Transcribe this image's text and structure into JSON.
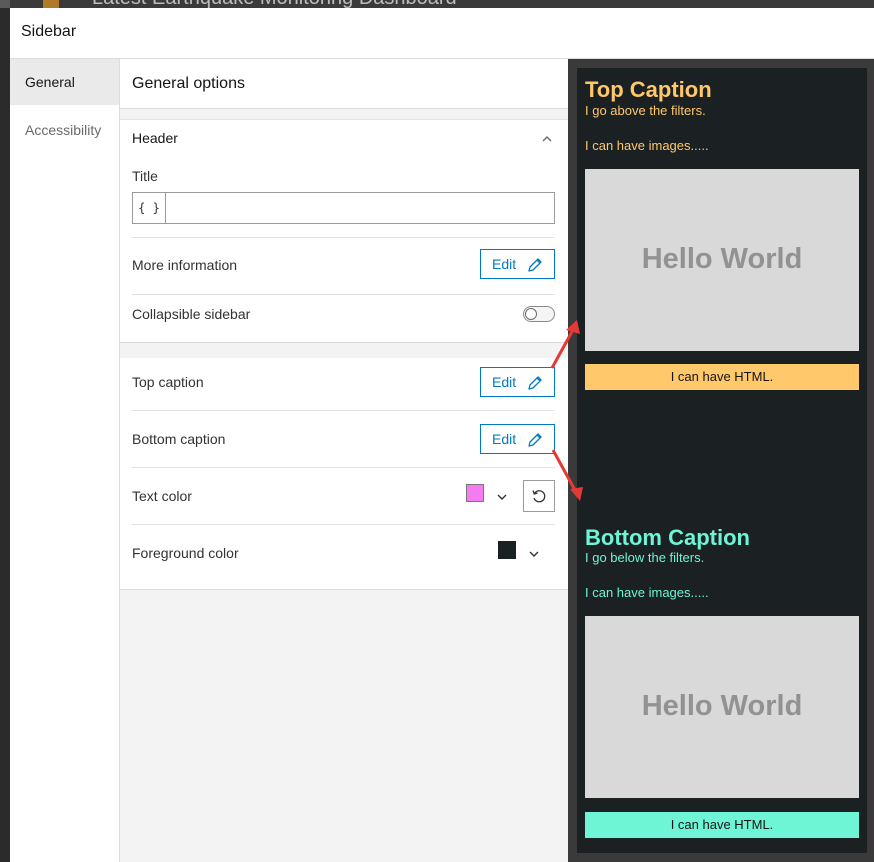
{
  "background_app": {
    "title": "Latest Earthquake Monitoring Dashboard"
  },
  "dialog": {
    "title": "Sidebar"
  },
  "nav": {
    "items": [
      {
        "label": "General"
      },
      {
        "label": "Accessibility"
      }
    ]
  },
  "panel": {
    "title": "General options",
    "header_section": {
      "label": "Header",
      "title_label": "Title",
      "title_value": "",
      "title_placeholder": "",
      "brace_glyph": "{ }",
      "more_info_label": "More information",
      "collapsible_label": "Collapsible sidebar",
      "collapsible_on": false
    },
    "edit_label": "Edit",
    "top_caption_label": "Top caption",
    "bottom_caption_label": "Bottom caption",
    "text_color_label": "Text color",
    "text_color_value": "#f47cf0",
    "foreground_color_label": "Foreground color",
    "foreground_color_value": "#1b2023"
  },
  "preview": {
    "top": {
      "heading": "Top Caption",
      "sub": "I go above the filters.",
      "images_text": "I can have images.....",
      "image_text": "Hello World",
      "html_text": "I can have HTML.",
      "color": "#ffc86b"
    },
    "bottom": {
      "heading": "Bottom Caption",
      "sub": "I go below the filters.",
      "images_text": "I can have images.....",
      "image_text": "Hello World",
      "html_text": "I can have HTML.",
      "color": "#6ef5d6"
    }
  },
  "colors": {
    "accent": "#007ac2",
    "annotation_arrow": "#e53935"
  }
}
